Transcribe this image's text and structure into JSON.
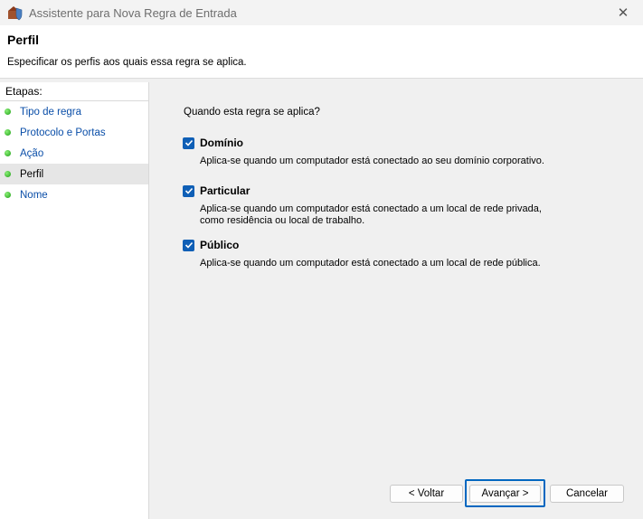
{
  "window": {
    "title": "Assistente para Nova Regra de Entrada",
    "close_glyph": "✕"
  },
  "header": {
    "title": "Perfil",
    "description": "Especificar os perfis aos quais essa regra se aplica."
  },
  "sidebar": {
    "heading": "Etapas:",
    "steps": [
      {
        "label": "Tipo de regra",
        "active": false
      },
      {
        "label": "Protocolo e Portas",
        "active": false
      },
      {
        "label": "Ação",
        "active": false
      },
      {
        "label": "Perfil",
        "active": true
      },
      {
        "label": "Nome",
        "active": false
      }
    ]
  },
  "main": {
    "question": "Quando esta regra se aplica?",
    "options": [
      {
        "label": "Domínio",
        "checked": true,
        "description": "Aplica-se quando um computador está conectado ao seu domínio corporativo."
      },
      {
        "label": "Particular",
        "checked": true,
        "description": "Aplica-se quando um computador está conectado a um local de rede privada, como residência ou local de trabalho."
      },
      {
        "label": "Público",
        "checked": true,
        "description": "Aplica-se quando um computador está conectado a um local de rede pública."
      }
    ]
  },
  "buttons": {
    "back": "< Voltar",
    "next": "Avançar >",
    "cancel": "Cancelar"
  },
  "colors": {
    "checkbox": "#0f5fb6",
    "link": "#0a4ea8",
    "focus": "#0067c0"
  }
}
